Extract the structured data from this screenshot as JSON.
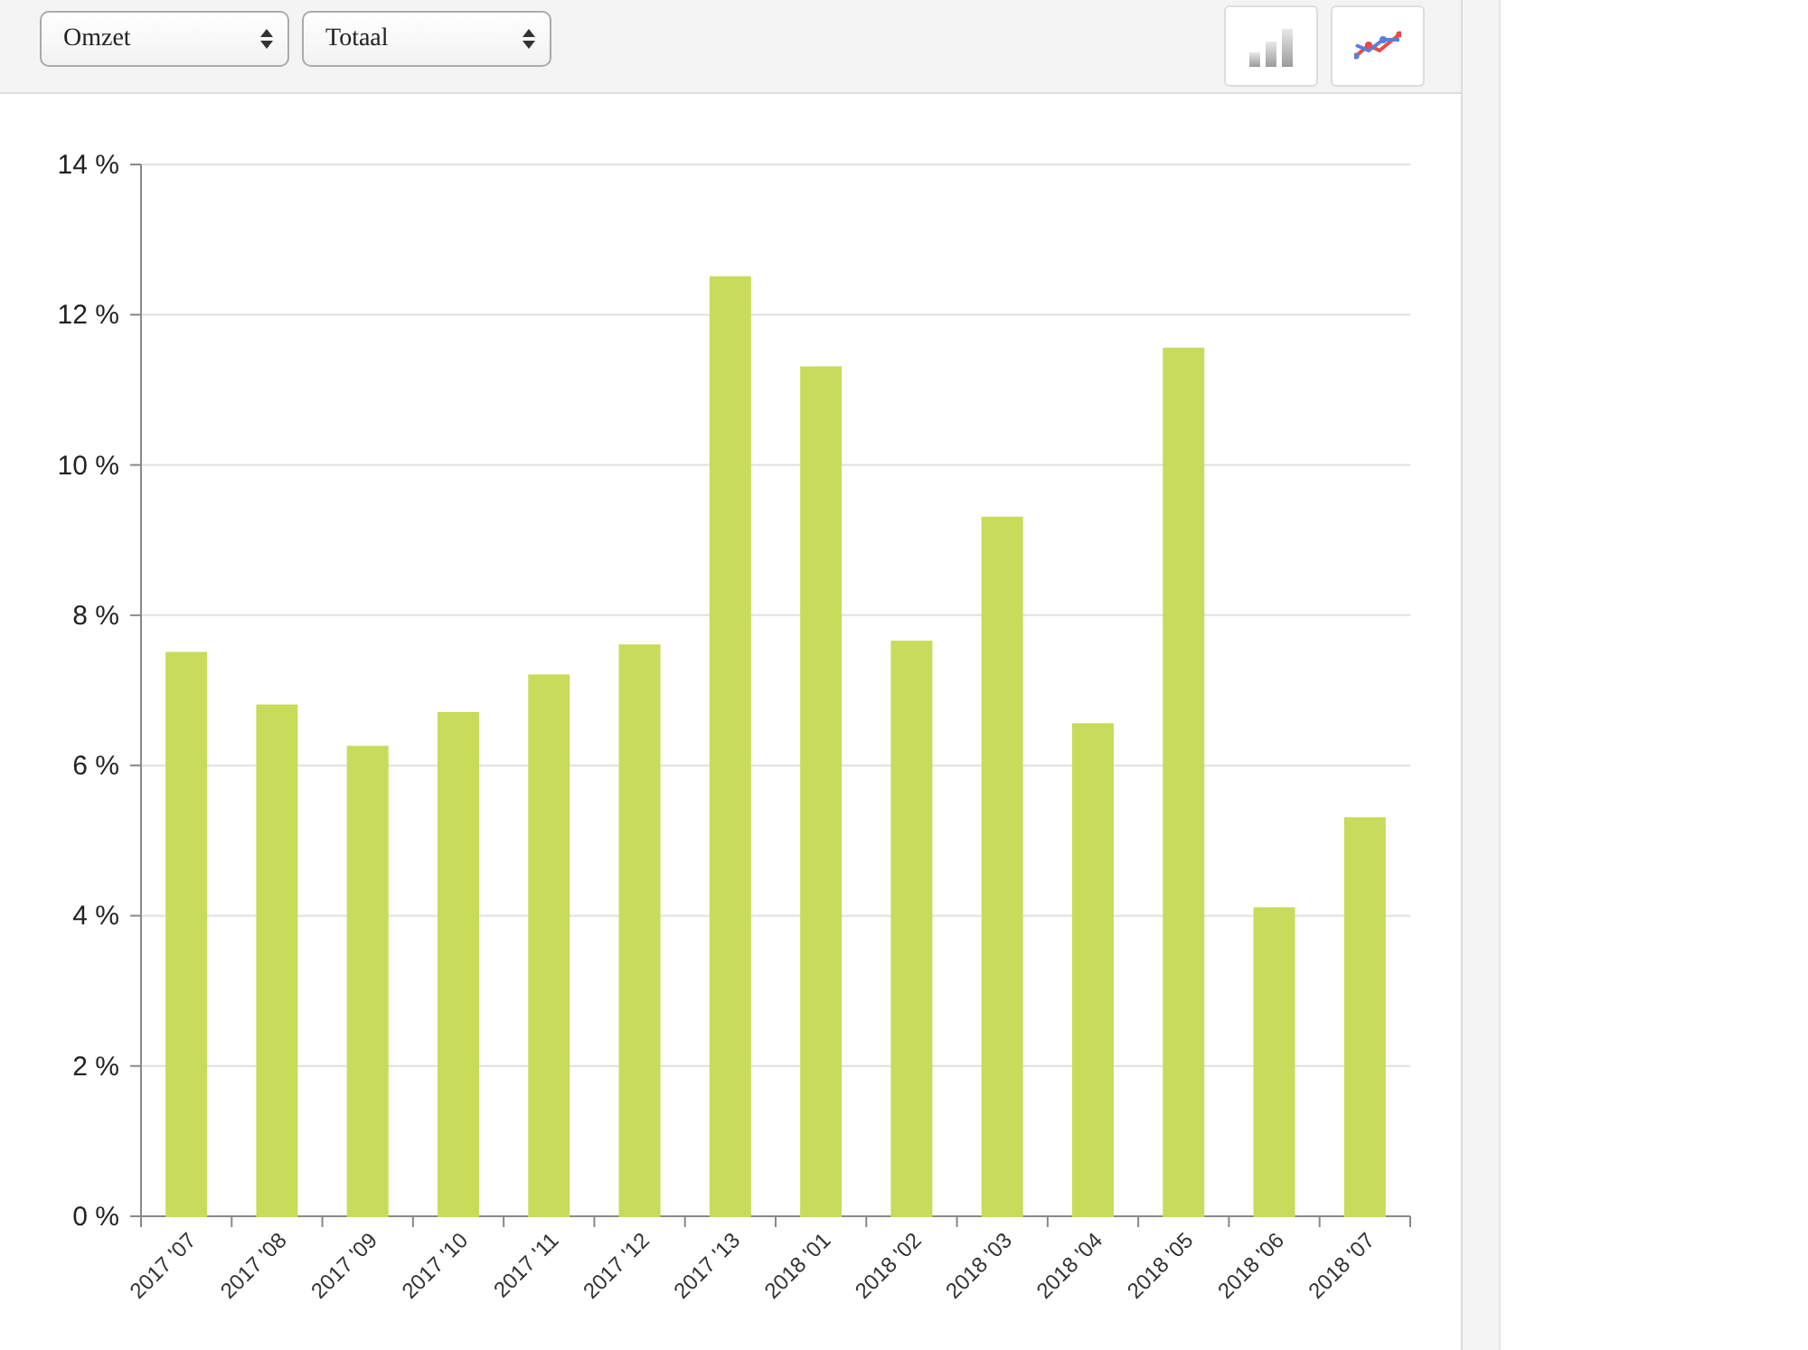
{
  "toolbar": {
    "dropdowns": [
      {
        "value": "Omzet"
      },
      {
        "value": "Totaal"
      }
    ],
    "view_buttons": [
      {
        "kind": "bar",
        "selected": false
      },
      {
        "kind": "line",
        "selected": false
      }
    ]
  },
  "chart_data": {
    "type": "bar",
    "categories": [
      "2017 '07",
      "2017 '08",
      "2017 '09",
      "2017 '10",
      "2017 '11",
      "2017 '12",
      "2017 '13",
      "2018 '01",
      "2018 '02",
      "2018 '03",
      "2018 '04",
      "2018 '05",
      "2018 '06",
      "2018 '07"
    ],
    "grid": true,
    "series": [
      {
        "color": "#c9db5a",
        "values": [
          7.5,
          6.8,
          6.25,
          6.7,
          7.2,
          7.6,
          12.5,
          11.3,
          7.65,
          9.3,
          6.55,
          11.55,
          4.1,
          5.3
        ]
      }
    ],
    "ylim": [
      0,
      14
    ],
    "yticks": [
      {
        "value": 0,
        "label": "0 %"
      },
      {
        "value": 2,
        "label": "2 %"
      },
      {
        "value": 4,
        "label": "4 %"
      },
      {
        "value": 6,
        "label": "6 %"
      },
      {
        "value": 8,
        "label": "8 %"
      },
      {
        "value": 10,
        "label": "10 %"
      },
      {
        "value": 12,
        "label": "12 %"
      },
      {
        "value": 14,
        "label": "14 %"
      }
    ]
  }
}
